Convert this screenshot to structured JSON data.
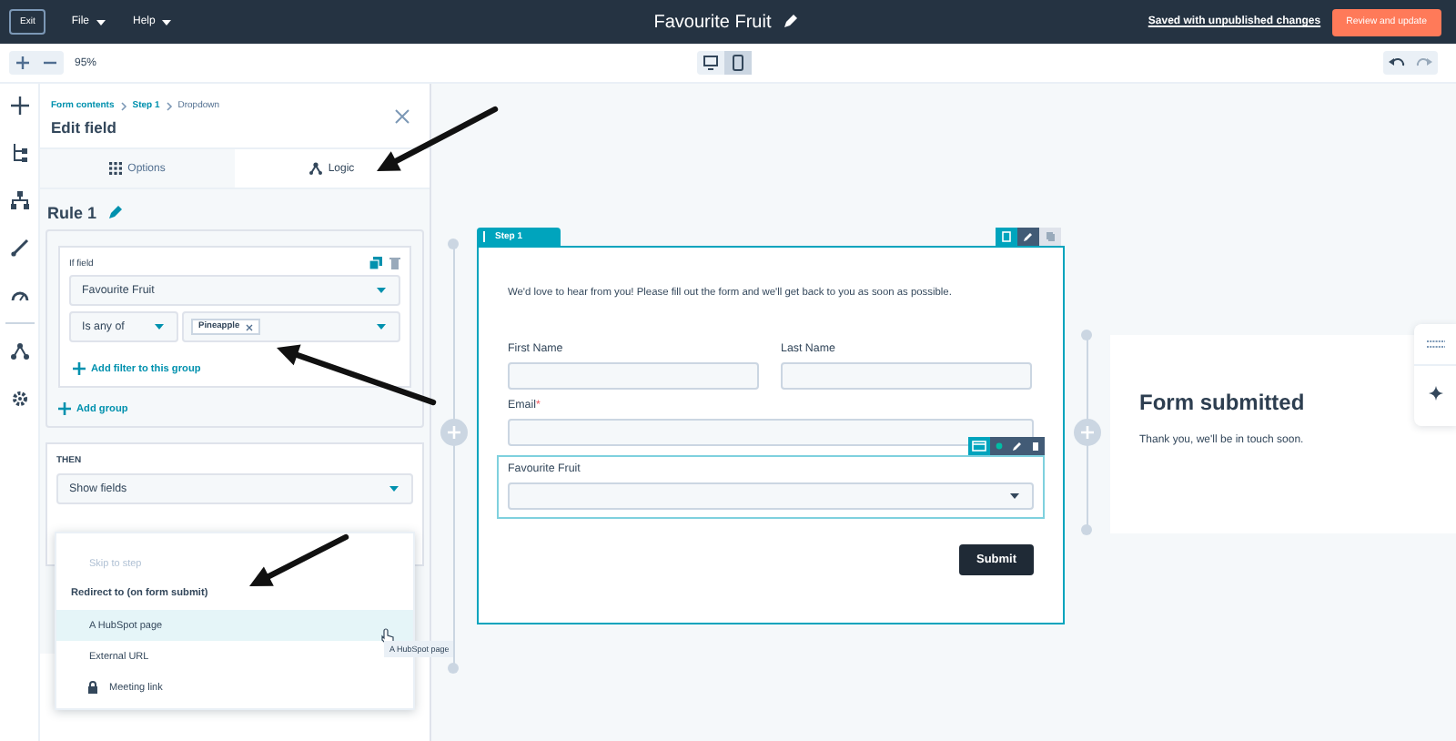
{
  "top_bar": {
    "exit": "Exit",
    "menus": [
      {
        "label": "File"
      },
      {
        "label": "Help"
      }
    ],
    "title": "Favourite Fruit",
    "save_status": "Saved with unpublished changes",
    "primary_button": "Review and update"
  },
  "toolbar": {
    "zoom": "95%",
    "devices": [
      {
        "kind": "desktop",
        "selected": false
      },
      {
        "kind": "mobile",
        "selected": true
      }
    ]
  },
  "panel": {
    "breadcrumbs": [
      "Form contents",
      "Step 1",
      "Dropdown"
    ],
    "title": "Edit field",
    "tabs": [
      {
        "label": "Options",
        "kind": "grid",
        "selected": false
      },
      {
        "label": "Logic",
        "kind": "logic",
        "selected": true
      }
    ],
    "rule": {
      "title": "Rule 1",
      "if_label": "If field",
      "field": "Favourite Fruit",
      "operator": "Is any of",
      "values": [
        "Pineapple"
      ],
      "add_filter": "Add filter to this group",
      "add_group": "Add group"
    },
    "then": {
      "label": "THEN",
      "action": "Show fields"
    },
    "menu": [
      {
        "kind": "option",
        "label": "Skip to step",
        "disabled": true,
        "selected": false,
        "locked": false
      },
      {
        "kind": "header",
        "label": "Redirect to (on form submit)"
      },
      {
        "kind": "option",
        "label": "A HubSpot page",
        "disabled": false,
        "selected": true,
        "locked": false
      },
      {
        "kind": "option",
        "label": "External URL",
        "disabled": false,
        "selected": false,
        "locked": false
      },
      {
        "kind": "option",
        "label": "Meeting link",
        "disabled": false,
        "selected": false,
        "locked": true
      }
    ],
    "tooltip": "A HubSpot page"
  },
  "canvas": {
    "step": {
      "label": "Step 1",
      "intro": "We'd love to hear from you! Please fill out the form and we'll get back to you as soon as possible.",
      "fields": [
        {
          "kind": "text",
          "label": "First Name",
          "half": true,
          "selected": false
        },
        {
          "kind": "text",
          "label": "Last Name",
          "half": true,
          "selected": false
        },
        {
          "kind": "text",
          "label": "Email",
          "required_mark": "*",
          "half": false,
          "selected": false
        },
        {
          "kind": "dropdown",
          "label": "Favourite Fruit",
          "half": false,
          "selected": true
        }
      ],
      "submit": "Submit"
    },
    "end": {
      "title": "Form submitted",
      "message": "Thank you, we'll be in touch soon."
    }
  }
}
